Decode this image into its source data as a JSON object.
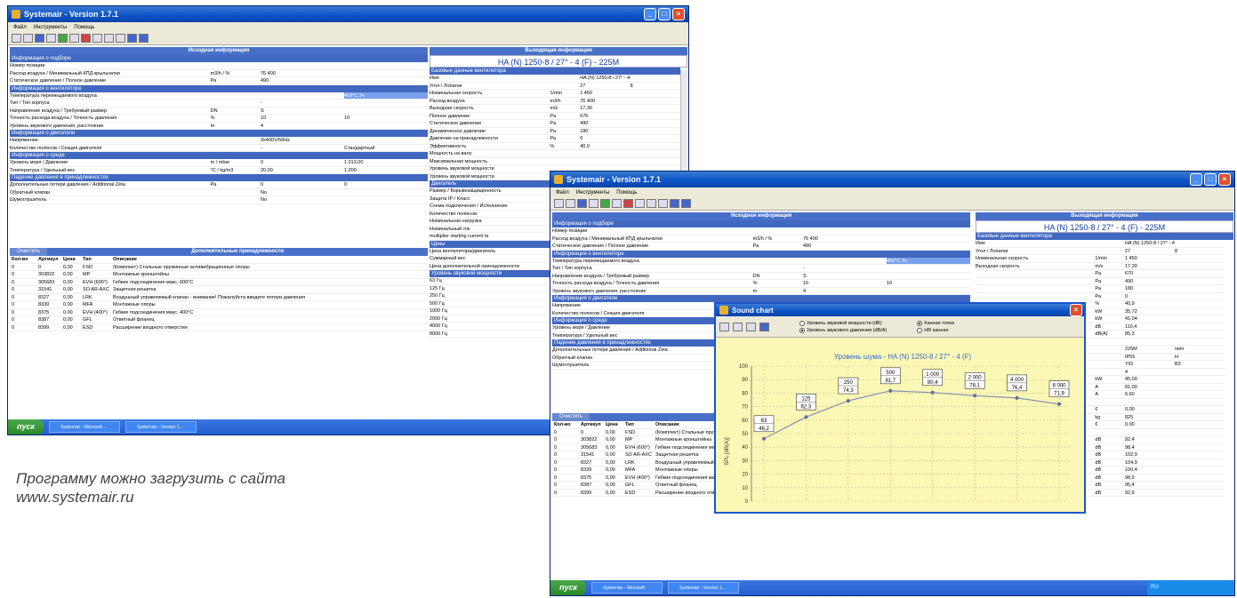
{
  "app": {
    "title": "Systemair - Version 1.7.1",
    "menu": [
      "Файл",
      "Инструменты",
      "Помощь"
    ]
  },
  "left_panel": {
    "header": "Исходная информация",
    "groups": [
      {
        "title": "Информация о подборе",
        "rows": [
          [
            "Номер позиции",
            "",
            "",
            ""
          ],
          [
            "Расход воздуха / Минимальный КПД крыльчатки",
            "m3/h / %",
            "76 400",
            ""
          ],
          [
            "Статическое давление / Полное давление",
            "Pa",
            "490",
            ""
          ]
        ]
      },
      {
        "title": "Информация о вентиляторе",
        "rows": [
          [
            "Температура перемещаемого воздуха",
            "",
            "",
            "400°C 2ч"
          ],
          [
            "Тип / Тип корпуса",
            "",
            "-",
            ""
          ],
          [
            "Направление воздуха / Требуемый размер",
            "DN",
            "S",
            ""
          ],
          [
            "Точность расхода воздуха / Точность давления",
            "%",
            "10",
            "10"
          ],
          [
            "Уровень звукового давления, расстояние",
            "m",
            "4",
            ""
          ]
        ]
      },
      {
        "title": "Информация о двигателе",
        "rows": [
          [
            "Напряжение",
            "",
            "3x400V/50Hz",
            ""
          ],
          [
            "Количество полюсов / Секция двигателя",
            "",
            "-",
            "Стандартный"
          ]
        ]
      },
      {
        "title": "Информация о среде",
        "rows": [
          [
            "Уровень моря / Давление",
            "m / mbar",
            "0",
            "1 013,00"
          ],
          [
            "Температура / Удельный вес",
            "°C / kg/m3",
            "20,00",
            "1,200"
          ]
        ]
      },
      {
        "title": "Падение давления в принадлежностях",
        "rows": [
          [
            "Дополнительные потери давления / Additional Zeta",
            "Pa",
            "0",
            "0"
          ],
          [
            "Обратный клапан",
            "",
            "No",
            ""
          ],
          [
            "Шумоглушитель",
            "",
            "No",
            ""
          ]
        ]
      }
    ],
    "clear_button": "Очистить",
    "accessories_header": "Дополнительные принадлежности",
    "table_headers": [
      "Кол-во",
      "Артикул",
      "Цена",
      "Тип",
      "Описание"
    ],
    "table_rows": [
      [
        "0",
        "0",
        "0,00",
        "FSD",
        "(Комплект) Стальные пружинные антивибрационные опоры"
      ],
      [
        "0",
        "303822",
        "0,00",
        "MP",
        "Монтажные кронштейны"
      ],
      [
        "0",
        "305683",
        "0,00",
        "EVH (600°)",
        "Гибкие подсоединения макс. 600°C"
      ],
      [
        "0",
        "31541",
        "0,00",
        "SO AR-AXC",
        "Защитная решетка"
      ],
      [
        "0",
        "8327",
        "0,00",
        "LRK",
        "Воздушный управляемый клапан - внимание! Пожалуйста введите потери давления"
      ],
      [
        "0",
        "8339",
        "0,00",
        "MFA",
        "Монтажные опоры"
      ],
      [
        "0",
        "8375",
        "0,00",
        "EVH (400°)",
        "Гибкие подсоединения макс. 400°C"
      ],
      [
        "0",
        "8387",
        "0,00",
        "GFL",
        "Ответный фланец"
      ],
      [
        "0",
        "8399",
        "0,00",
        "ESD",
        "Расширение входного отверстия"
      ]
    ]
  },
  "right_panel": {
    "header": "Выходящая информация",
    "product_title": "HA (N) 1250-8 / 27° - 4 (F) - 225M",
    "groups": [
      {
        "title": "Базовые данные вентилятора",
        "rows": [
          [
            "Имя",
            "",
            "HA (N) 1250-8 / 27° - 4 (F)",
            ""
          ],
          [
            "Угол / Лопатки",
            "",
            "27",
            "8"
          ],
          [
            "Номинальная скорость",
            "1/min",
            "1 450",
            ""
          ],
          [
            "Расход воздуха",
            "m3/h",
            "76 400",
            ""
          ],
          [
            "Выходная скорость",
            "m/s",
            "17,30",
            ""
          ],
          [
            "Полное давление",
            "Pa",
            "670",
            ""
          ],
          [
            "Статическое давление",
            "Pa",
            "490",
            ""
          ],
          [
            "Динамическое давление",
            "Pa",
            "180",
            ""
          ],
          [
            "Давление на принадлежности",
            "Pa",
            "0",
            ""
          ],
          [
            "Эффективность",
            "%",
            "40,9",
            ""
          ],
          [
            "Мощность на валу",
            "",
            "",
            ""
          ],
          [
            "Максимальная мощность",
            "",
            "",
            ""
          ],
          [
            "Уровень звуковой мощности",
            "",
            "",
            ""
          ],
          [
            "Уровень звуковой мощности",
            "",
            "",
            ""
          ]
        ]
      },
      {
        "title": "Двигатель",
        "rows": [
          [
            "Размер / Взрывозащищенность",
            "",
            "",
            ""
          ],
          [
            "Защита IP / Класс",
            "",
            "",
            ""
          ],
          [
            "Схема подключения / Исполнение",
            "",
            "",
            ""
          ],
          [
            "Количество полюсов",
            "",
            "",
            ""
          ],
          [
            "Номинальная нагрузка",
            "",
            "",
            ""
          ],
          [
            "Номинальный ток",
            "",
            "",
            ""
          ],
          [
            "multiplier starting current Ia",
            "",
            "",
            ""
          ]
        ]
      },
      {
        "title": "Цены",
        "rows": [
          [
            "Цена вентилятора/двигатель",
            "",
            "",
            ""
          ],
          [
            "Суммарный вес",
            "",
            "",
            ""
          ],
          [
            "Цена дополнительной принадлежности",
            "",
            "",
            ""
          ]
        ]
      },
      {
        "title": "Уровень звуковой мощности",
        "rows": [
          [
            "63 Гц",
            "",
            "",
            ""
          ],
          [
            "125 Гц",
            "",
            "",
            ""
          ],
          [
            "250 Гц",
            "",
            "",
            ""
          ],
          [
            "500 Гц",
            "",
            "",
            ""
          ],
          [
            "1000 Гц",
            "",
            "",
            ""
          ],
          [
            "2000 Гц",
            "",
            "",
            ""
          ],
          [
            "4000 Гц",
            "",
            "",
            ""
          ],
          [
            "8000 Гц",
            "",
            "",
            ""
          ]
        ]
      }
    ]
  },
  "right_panel_2": {
    "rows": [
      [
        "Имя",
        "",
        "HA (N) 1250-8 / 27° - 4 (F)",
        ""
      ],
      [
        "Угол / Лопатки",
        "",
        "27",
        "8"
      ],
      [
        "Номинальная скорость",
        "1/min",
        "1 450",
        ""
      ],
      [
        "Выходная скорость",
        "m/s",
        "17,30",
        ""
      ],
      [
        "",
        "Pa",
        "670",
        ""
      ],
      [
        "",
        "Pa",
        "490",
        ""
      ],
      [
        "",
        "Pa",
        "180",
        ""
      ],
      [
        "",
        "Pa",
        "0",
        ""
      ],
      [
        "",
        "%",
        "40,9",
        ""
      ],
      [
        "",
        "kW",
        "35,72",
        ""
      ],
      [
        "",
        "kW",
        "41,04",
        ""
      ],
      [
        "",
        "dB",
        "110,4",
        ""
      ],
      [
        "",
        "dB(A)",
        "85,3",
        ""
      ],
      [
        "",
        "",
        "",
        ""
      ],
      [
        "",
        "",
        "225M",
        "nein"
      ],
      [
        "",
        "",
        "IP55",
        "H"
      ],
      [
        "",
        "",
        "Y/D",
        "B3"
      ],
      [
        "",
        "",
        "4",
        ""
      ],
      [
        "",
        "kW",
        "45,00",
        ""
      ],
      [
        "",
        "A",
        "81,00",
        ""
      ],
      [
        "",
        "A",
        "6,60",
        ""
      ],
      [
        "",
        "",
        "",
        ""
      ],
      [
        "",
        "€",
        "0,00",
        ""
      ],
      [
        "",
        "kg",
        "825",
        ""
      ],
      [
        "",
        "€",
        "0,00",
        ""
      ],
      [
        "",
        "",
        "",
        ""
      ],
      [
        "",
        "dB",
        "92,4",
        ""
      ],
      [
        "",
        "dB",
        "98,4",
        ""
      ],
      [
        "250 Гц",
        "dB",
        "102,9",
        ""
      ],
      [
        "500 Гц",
        "dB",
        "104,9",
        ""
      ],
      [
        "1000 Гц",
        "dB",
        "100,4",
        ""
      ],
      [
        "2000 Гц",
        "dB",
        "98,9",
        ""
      ],
      [
        "4000 Гц",
        "dB",
        "95,4",
        ""
      ],
      [
        "8000 Гц",
        "dB",
        "92,9",
        ""
      ]
    ]
  },
  "taskbar": {
    "start": "пуск",
    "items": [
      "Systemair - Microsoft ...",
      "Systemair - Version 1..."
    ],
    "items2": [
      "Systemair - Microsoft",
      "Systemair - Version 1..."
    ],
    "clock": "RU"
  },
  "caption": {
    "line1": "Программу можно загрузить с сайта",
    "line2": "www.systemair.ru"
  },
  "sound_chart": {
    "window_title": "Sound chart",
    "radio_left": [
      "Уровень звуковой мощности (dB)",
      "Уровень звукового давления (dB/A)"
    ],
    "radio_right": [
      "Канная точка",
      "HR канная"
    ],
    "chart_data": {
      "type": "line",
      "title": "Уровень шума - HA (N) 1250-8 / 27° - 4 (F)",
      "ylabel": "SPL [dB(A)]",
      "ylim": [
        0,
        100
      ],
      "yticks": [
        0,
        10,
        20,
        30,
        40,
        50,
        60,
        70,
        80,
        90,
        100
      ],
      "x": [
        63,
        125,
        250,
        500,
        1000,
        2000,
        4000,
        8000
      ],
      "y": [
        46.2,
        62.3,
        74.3,
        81.7,
        80.4,
        78.1,
        76.4,
        71.9
      ],
      "labels": [
        [
          "63",
          "46,2"
        ],
        [
          "125",
          "62,3"
        ],
        [
          "250",
          "74,3"
        ],
        [
          "500",
          "81,7"
        ],
        [
          "1 000",
          "80,4"
        ],
        [
          "2 000",
          "78,1"
        ],
        [
          "4 000",
          "76,4"
        ],
        [
          "8 000",
          "71,9"
        ]
      ]
    }
  }
}
